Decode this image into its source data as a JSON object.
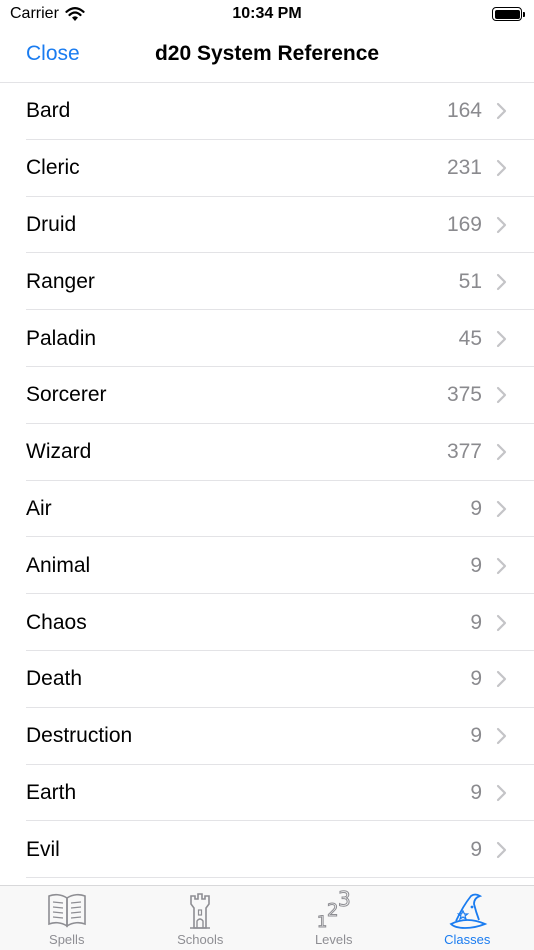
{
  "status": {
    "carrier": "Carrier",
    "time": "10:34 PM"
  },
  "nav": {
    "close_label": "Close",
    "title": "d20 System Reference"
  },
  "rows": [
    {
      "label": "Bard",
      "count": "164"
    },
    {
      "label": "Cleric",
      "count": "231"
    },
    {
      "label": "Druid",
      "count": "169"
    },
    {
      "label": "Ranger",
      "count": "51"
    },
    {
      "label": "Paladin",
      "count": "45"
    },
    {
      "label": "Sorcerer",
      "count": "375"
    },
    {
      "label": "Wizard",
      "count": "377"
    },
    {
      "label": "Air",
      "count": "9"
    },
    {
      "label": "Animal",
      "count": "9"
    },
    {
      "label": "Chaos",
      "count": "9"
    },
    {
      "label": "Death",
      "count": "9"
    },
    {
      "label": "Destruction",
      "count": "9"
    },
    {
      "label": "Earth",
      "count": "9"
    },
    {
      "label": "Evil",
      "count": "9"
    }
  ],
  "tabs": [
    {
      "label": "Spells",
      "icon": "book-icon"
    },
    {
      "label": "Schools",
      "icon": "tower-icon"
    },
    {
      "label": "Levels",
      "icon": "levels-123-icon"
    },
    {
      "label": "Classes",
      "icon": "wizard-hat-icon",
      "active": true
    }
  ],
  "colors": {
    "accent": "#1a7cf0",
    "secondary_text": "#8a8a8e",
    "separator": "#e3e3e6"
  }
}
